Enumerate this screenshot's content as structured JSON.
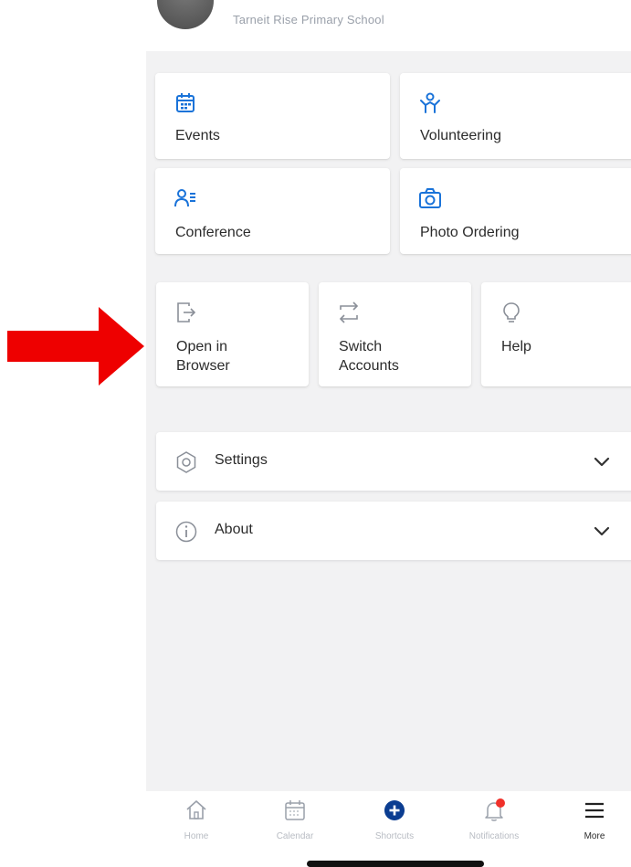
{
  "header": {
    "school_name": "Tarneit Rise Primary School"
  },
  "shortcuts": [
    {
      "label": "Events",
      "icon": "calendar-icon"
    },
    {
      "label": "Volunteering",
      "icon": "volunteer-icon"
    },
    {
      "label": "Conference",
      "icon": "conference-icon"
    },
    {
      "label": "Photo Ordering",
      "icon": "camera-icon"
    }
  ],
  "actions": [
    {
      "label": "Open in Browser",
      "line1": "Open in",
      "line2": "Browser",
      "icon": "open-external-icon"
    },
    {
      "label": "Switch Accounts",
      "line1": "Switch",
      "line2": "Accounts",
      "icon": "switch-icon"
    },
    {
      "label": "Help",
      "line1": "Help",
      "line2": "",
      "icon": "lightbulb-icon"
    }
  ],
  "sections": [
    {
      "label": "Settings",
      "icon": "gear-icon"
    },
    {
      "label": "About",
      "icon": "info-icon"
    }
  ],
  "tabs": [
    {
      "label": "Home",
      "icon": "home-icon"
    },
    {
      "label": "Calendar",
      "icon": "calendar-icon"
    },
    {
      "label": "Shortcuts",
      "icon": "plus-circle-icon"
    },
    {
      "label": "Notifications",
      "icon": "bell-icon"
    },
    {
      "label": "More",
      "icon": "menu-icon"
    }
  ],
  "colors": {
    "accent": "#1a73d9",
    "shortcuts_tab": "#0b3d91",
    "notification_badge": "#f0302a",
    "annotation_arrow": "#ee0000"
  }
}
